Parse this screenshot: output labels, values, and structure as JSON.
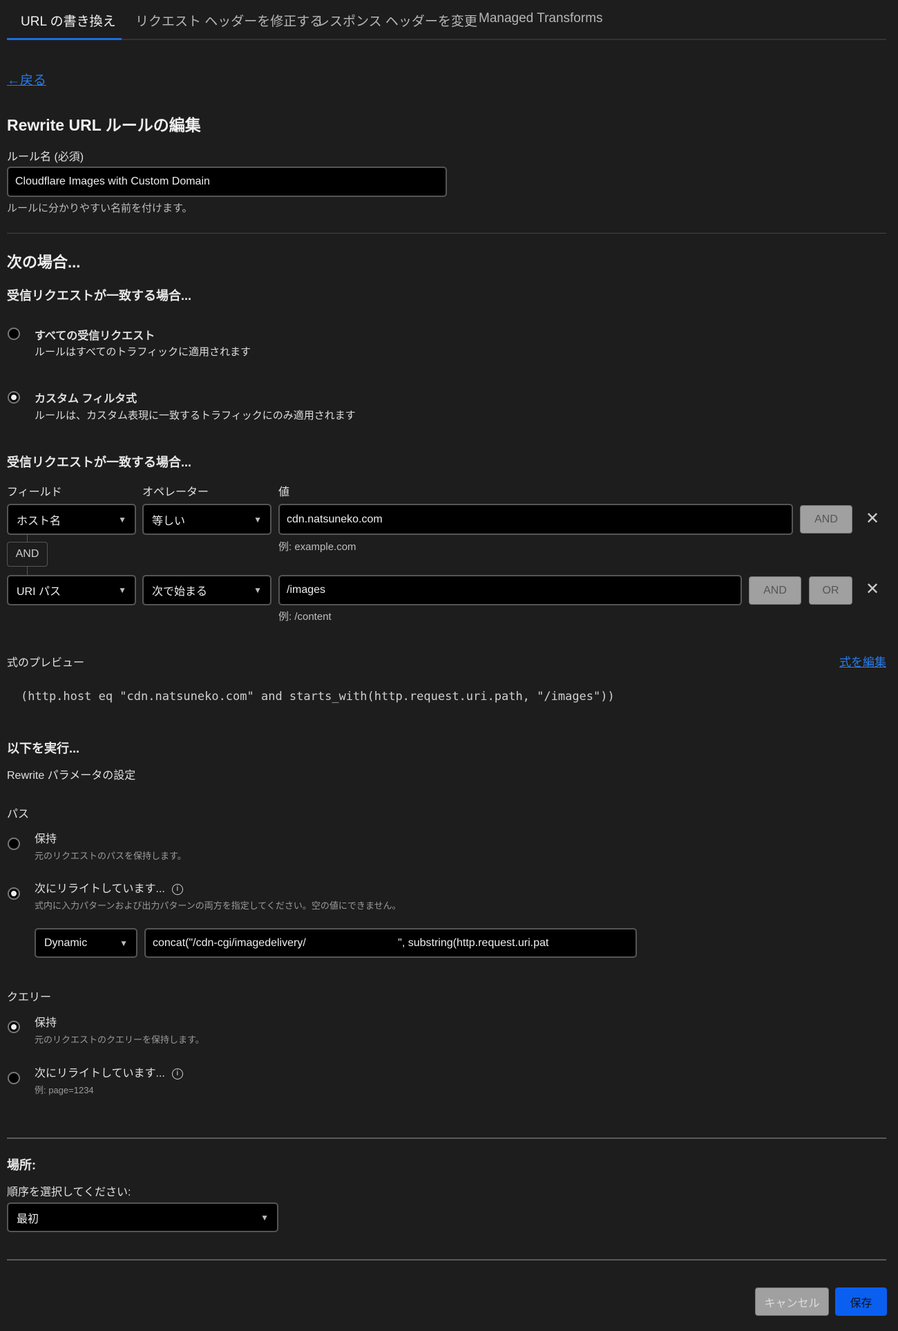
{
  "tabs": [
    "URL の書き換え",
    "リクエスト ヘッダーを修正する",
    "レスポンス ヘッダーを変更",
    "Managed Transforms"
  ],
  "back_link": "←戻る",
  "title": "Rewrite URL ルールの編集",
  "rule_name": {
    "label": "ルール名 (必須)",
    "value": "Cloudflare Images with Custom Domain",
    "help": "ルールに分かりやすい名前を付けます。"
  },
  "when": {
    "heading": "次の場合...",
    "subheading": "受信リクエストが一致する場合...",
    "options": [
      {
        "title": "すべての受信リクエスト",
        "desc": "ルールはすべてのトラフィックに適用されます",
        "selected": false
      },
      {
        "title": "カスタム フィルタ式",
        "desc": "ルールは、カスタム表現に一致するトラフィックにのみ適用されます",
        "selected": true
      }
    ]
  },
  "filter": {
    "heading": "受信リクエストが一致する場合...",
    "col_field": "フィールド",
    "col_operator": "オペレーター",
    "col_value": "値",
    "rows": [
      {
        "field": "ホスト名",
        "operator": "等しい",
        "value": "cdn.natsuneko.com",
        "example": "例: example.com"
      },
      {
        "field": "URI パス",
        "operator": "次で始まる",
        "value": "/images",
        "example": "例: /content"
      }
    ],
    "and_chip": "AND",
    "and_btn": "AND",
    "or_btn": "OR"
  },
  "preview": {
    "label": "式のプレビュー",
    "edit_link": "式を編集",
    "expression": "(http.host eq \"cdn.natsuneko.com\" and starts_with(http.request.uri.path, \"/images\"))"
  },
  "then": {
    "heading": "以下を実行...",
    "sub": "Rewrite パラメータの設定",
    "path": {
      "label": "パス",
      "keep_title": "保持",
      "keep_desc": "元のリクエストのパスを保持します。",
      "rewrite_title": "次にリライトしています...",
      "rewrite_desc": "式内に入力パターンおよび出力パターンの両方を指定してください。空の値にできません。",
      "type": "Dynamic",
      "value": "concat(\"/cdn-cgi/imagedelivery/                              \", substring(http.request.uri.pat",
      "selected": "rewrite"
    },
    "query": {
      "label": "クエリー",
      "keep_title": "保持",
      "keep_desc": "元のリクエストのクエリーを保持します。",
      "rewrite_title": "次にリライトしています...",
      "rewrite_desc": "例: page=1234",
      "selected": "keep"
    }
  },
  "place": {
    "heading": "場所:",
    "label": "順序を選択してください:",
    "value": "最初"
  },
  "buttons": {
    "cancel": "キャンセル",
    "save": "保存"
  },
  "colors": {
    "accent": "#1a6de0",
    "save": "#0a5ff0"
  }
}
